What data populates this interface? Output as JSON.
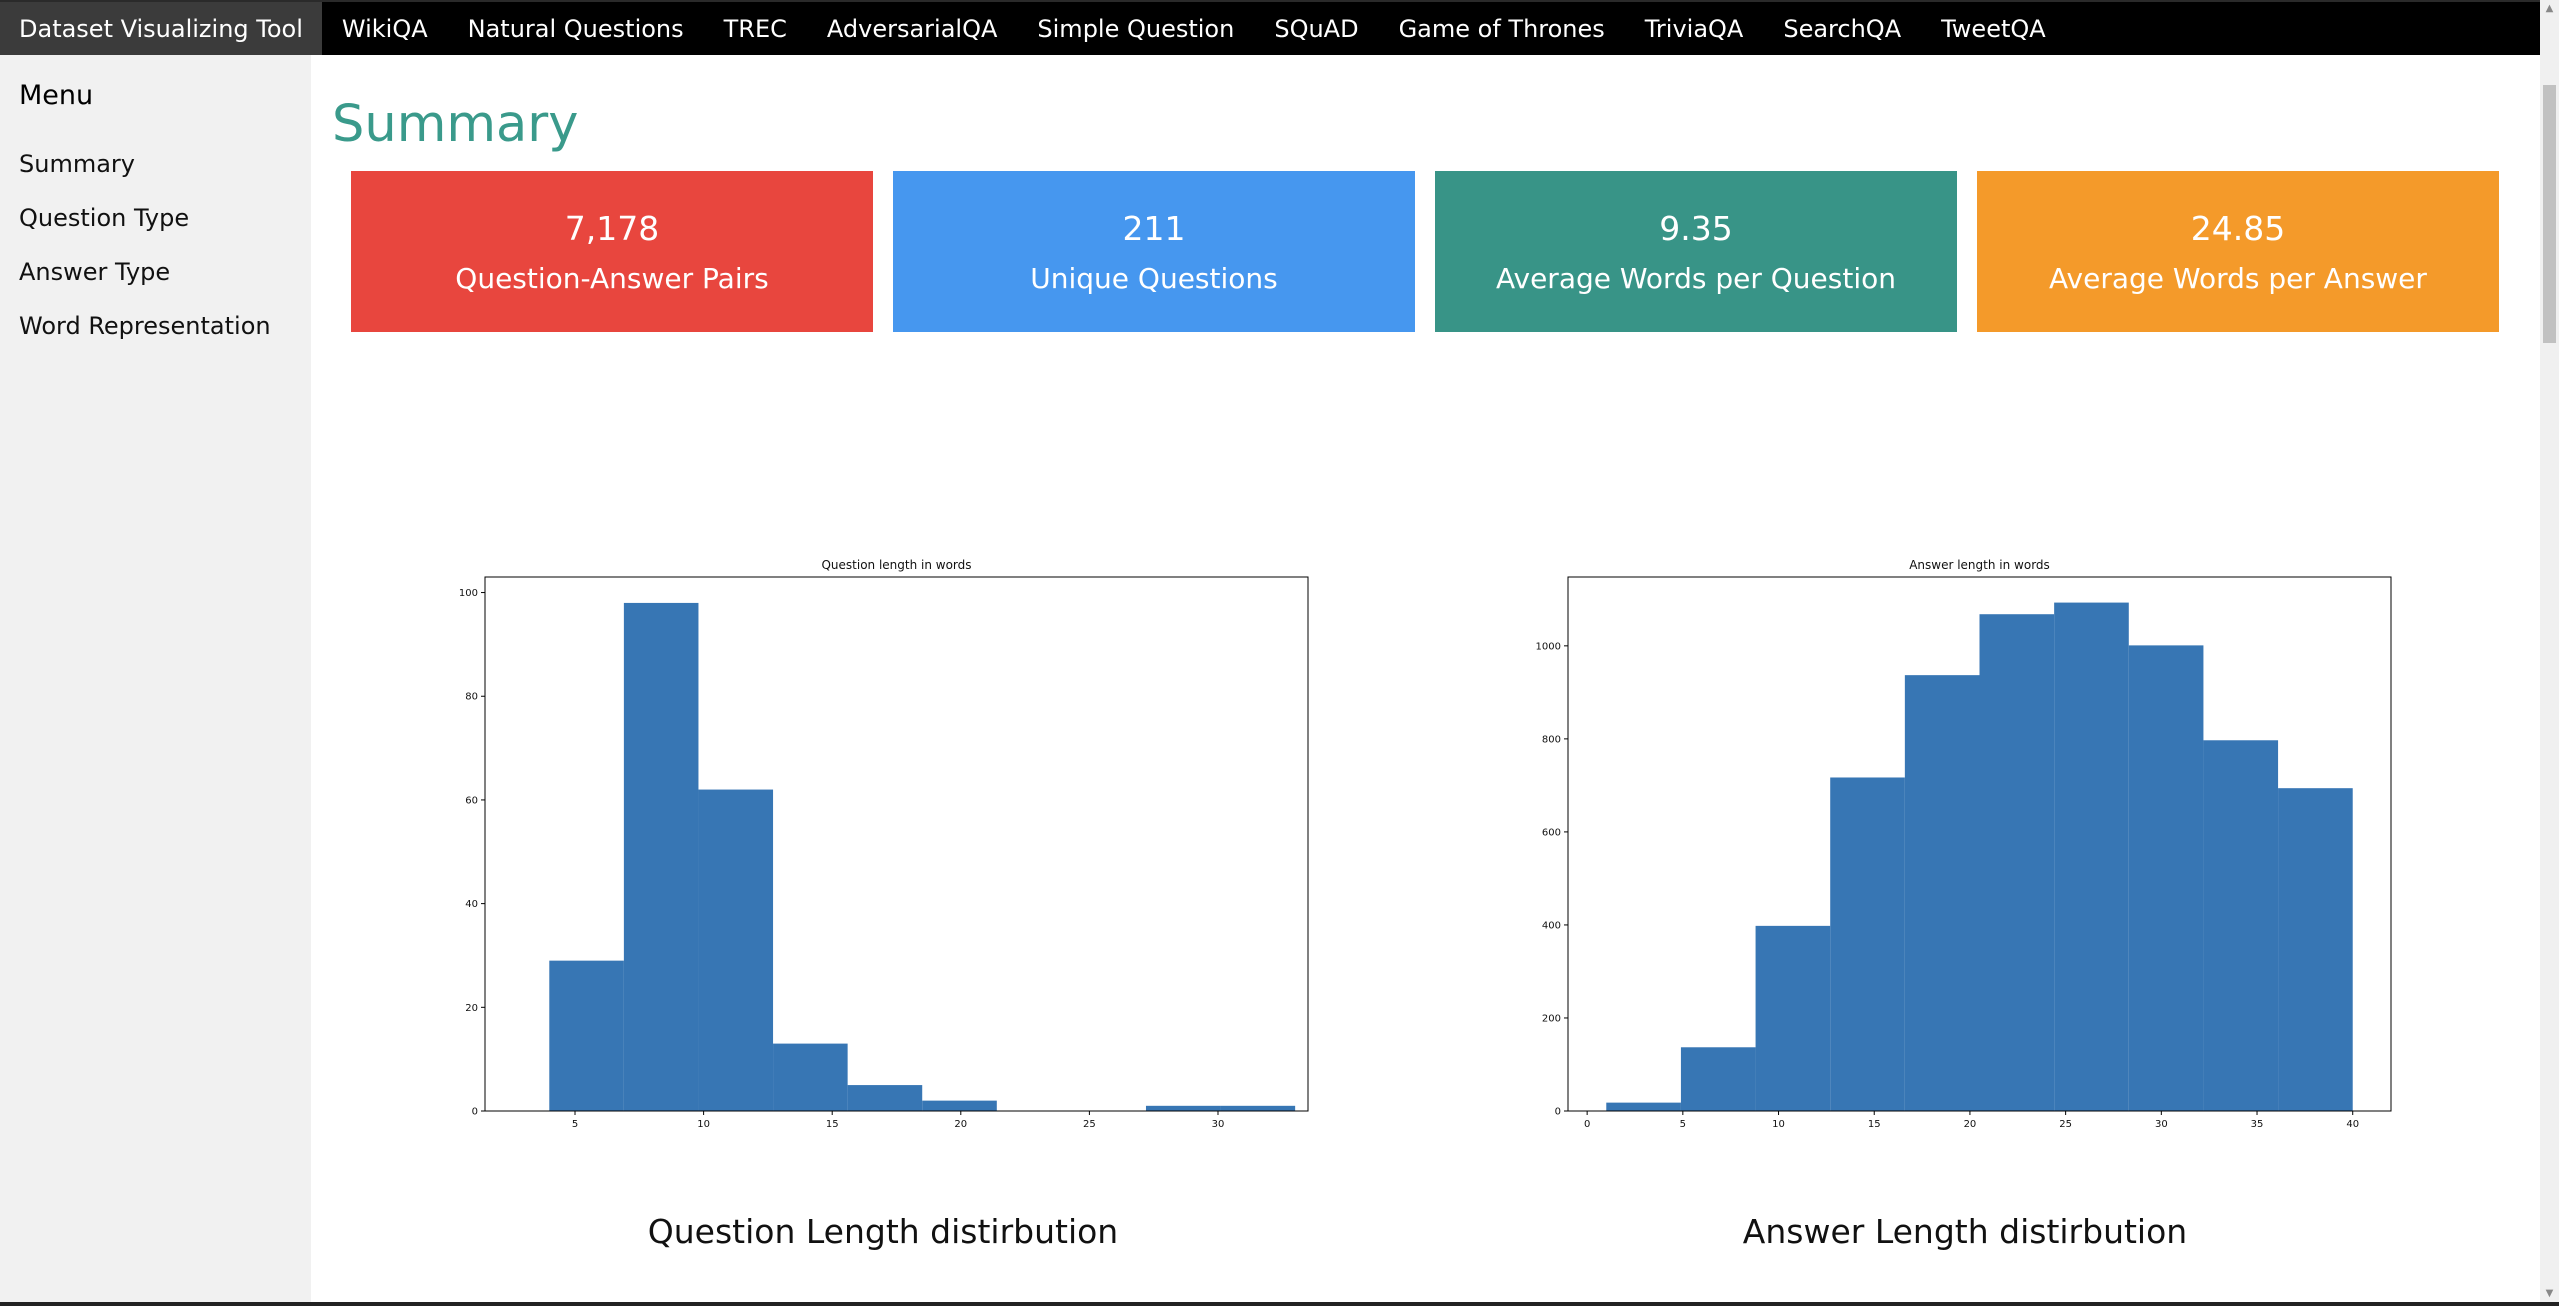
{
  "nav": {
    "brand": "Dataset Visualizing Tool",
    "items": [
      "WikiQA",
      "Natural Questions",
      "TREC",
      "AdversarialQA",
      "Simple Question",
      "SQuAD",
      "Game of Thrones",
      "TriviaQA",
      "SearchQA",
      "TweetQA"
    ]
  },
  "sidebar": {
    "title": "Menu",
    "items": [
      "Summary",
      "Question Type",
      "Answer Type",
      "Word Representation"
    ]
  },
  "main": {
    "title": "Summary",
    "cards": [
      {
        "value": "7,178",
        "label": "Question-Answer Pairs",
        "color": "#e8463e"
      },
      {
        "value": "211",
        "label": "Unique Questions",
        "color": "#4697ef"
      },
      {
        "value": "9.35",
        "label": "Average Words per Question",
        "color": "#389487"
      },
      {
        "value": "24.85",
        "label": "Average Words per Answer",
        "color": "#f49a2a"
      }
    ],
    "captions": [
      "Question Length distirbution",
      "Answer Length distirbution"
    ]
  },
  "chart_data": [
    {
      "type": "bar",
      "title": "Question length in words",
      "xlabel": "",
      "ylabel": "",
      "bins": [
        [
          4,
          6.9
        ],
        [
          6.9,
          9.8
        ],
        [
          9.8,
          12.7
        ],
        [
          12.7,
          15.6
        ],
        [
          15.6,
          18.5
        ],
        [
          18.5,
          21.4
        ],
        [
          21.4,
          24.3
        ],
        [
          24.3,
          27.2
        ],
        [
          27.2,
          30.1
        ],
        [
          30.1,
          33
        ]
      ],
      "values": [
        29,
        98,
        62,
        13,
        5,
        2,
        0,
        0,
        1,
        1
      ],
      "xlim": [
        1.5,
        33.5
      ],
      "ylim": [
        0,
        103
      ],
      "xticks": [
        5,
        10,
        15,
        20,
        25,
        30
      ],
      "yticks": [
        0,
        20,
        40,
        60,
        80,
        100
      ],
      "color": "#3776b4"
    },
    {
      "type": "bar",
      "title": "Answer length in words",
      "xlabel": "",
      "ylabel": "",
      "bins": [
        [
          1,
          4.9
        ],
        [
          4.9,
          8.8
        ],
        [
          8.8,
          12.7
        ],
        [
          12.7,
          16.6
        ],
        [
          16.6,
          20.5
        ],
        [
          20.5,
          24.4
        ],
        [
          24.4,
          28.3
        ],
        [
          28.3,
          32.2
        ],
        [
          32.2,
          36.1
        ],
        [
          36.1,
          40
        ]
      ],
      "values": [
        18,
        137,
        398,
        717,
        937,
        1068,
        1093,
        1001,
        797,
        694
      ],
      "xlim": [
        -1,
        42
      ],
      "ylim": [
        0,
        1148
      ],
      "xticks": [
        0,
        5,
        10,
        15,
        20,
        25,
        30,
        35,
        40
      ],
      "yticks": [
        0,
        200,
        400,
        600,
        800,
        1000
      ],
      "color": "#3776b4"
    }
  ]
}
